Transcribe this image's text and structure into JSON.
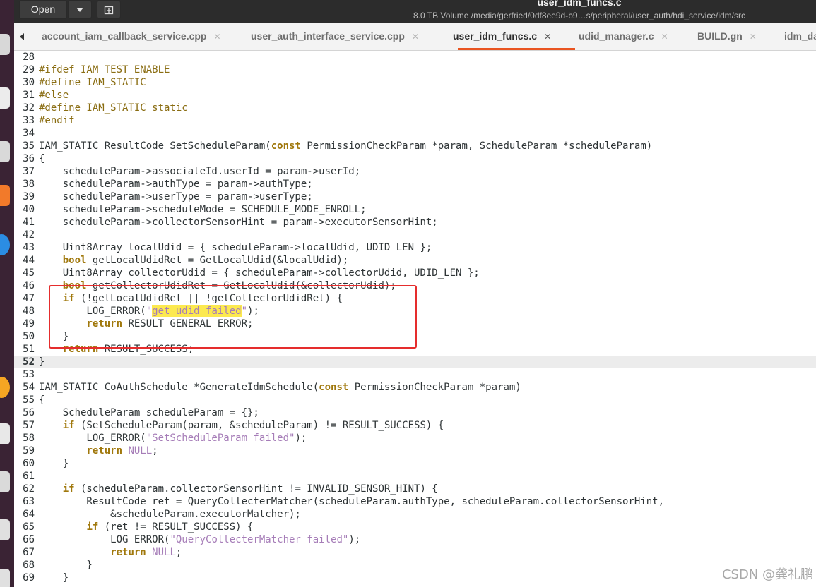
{
  "header": {
    "open_label": "Open",
    "window_title": "user_idm_funcs.c",
    "window_subtitle": "8.0 TB Volume /media/gerfried/0df8ee9d-b9…s/peripheral/user_auth/hdi_service/idm/src"
  },
  "tabs": [
    {
      "label": "account_iam_callback_service.cpp",
      "active": false
    },
    {
      "label": "user_auth_interface_service.cpp",
      "active": false
    },
    {
      "label": "user_idm_funcs.c",
      "active": true
    },
    {
      "label": "udid_manager.c",
      "active": false
    },
    {
      "label": "BUILD.gn",
      "active": false
    },
    {
      "label": "idm_da",
      "active": false
    }
  ],
  "editor": {
    "current_line": 52,
    "lines": [
      {
        "n": "28",
        "code": ""
      },
      {
        "n": "29",
        "code": "#ifdef IAM_TEST_ENABLE"
      },
      {
        "n": "30",
        "code": "#define IAM_STATIC"
      },
      {
        "n": "31",
        "code": "#else"
      },
      {
        "n": "32",
        "code": "#define IAM_STATIC static"
      },
      {
        "n": "33",
        "code": "#endif"
      },
      {
        "n": "34",
        "code": ""
      },
      {
        "n": "35",
        "code": "IAM_STATIC ResultCode SetScheduleParam(const PermissionCheckParam *param, ScheduleParam *scheduleParam)"
      },
      {
        "n": "36",
        "code": "{"
      },
      {
        "n": "37",
        "code": "    scheduleParam->associateId.userId = param->userId;"
      },
      {
        "n": "38",
        "code": "    scheduleParam->authType = param->authType;"
      },
      {
        "n": "39",
        "code": "    scheduleParam->userType = param->userType;"
      },
      {
        "n": "40",
        "code": "    scheduleParam->scheduleMode = SCHEDULE_MODE_ENROLL;"
      },
      {
        "n": "41",
        "code": "    scheduleParam->collectorSensorHint = param->executorSensorHint;"
      },
      {
        "n": "42",
        "code": ""
      },
      {
        "n": "43",
        "code": "    Uint8Array localUdid = { scheduleParam->localUdid, UDID_LEN };"
      },
      {
        "n": "44",
        "code": "    bool getLocalUdidRet = GetLocalUdid(&localUdid);"
      },
      {
        "n": "45",
        "code": "    Uint8Array collectorUdid = { scheduleParam->collectorUdid, UDID_LEN };"
      },
      {
        "n": "46",
        "code": "    bool getCollectorUdidRet = GetLocalUdid(&collectorUdid);"
      },
      {
        "n": "47",
        "code": "    if (!getLocalUdidRet || !getCollectorUdidRet) {"
      },
      {
        "n": "48",
        "code": "        LOG_ERROR(\"get udid failed\");"
      },
      {
        "n": "49",
        "code": "        return RESULT_GENERAL_ERROR;"
      },
      {
        "n": "50",
        "code": "    }"
      },
      {
        "n": "51",
        "code": "    return RESULT_SUCCESS;"
      },
      {
        "n": "52",
        "code": "}"
      },
      {
        "n": "53",
        "code": ""
      },
      {
        "n": "54",
        "code": "IAM_STATIC CoAuthSchedule *GenerateIdmSchedule(const PermissionCheckParam *param)"
      },
      {
        "n": "55",
        "code": "{"
      },
      {
        "n": "56",
        "code": "    ScheduleParam scheduleParam = {};"
      },
      {
        "n": "57",
        "code": "    if (SetScheduleParam(param, &scheduleParam) != RESULT_SUCCESS) {"
      },
      {
        "n": "58",
        "code": "        LOG_ERROR(\"SetScheduleParam failed\");"
      },
      {
        "n": "59",
        "code": "        return NULL;"
      },
      {
        "n": "60",
        "code": "    }"
      },
      {
        "n": "61",
        "code": ""
      },
      {
        "n": "62",
        "code": "    if (scheduleParam.collectorSensorHint != INVALID_SENSOR_HINT) {"
      },
      {
        "n": "63",
        "code": "        ResultCode ret = QueryCollecterMatcher(scheduleParam.authType, scheduleParam.collectorSensorHint,"
      },
      {
        "n": "64",
        "code": "            &scheduleParam.executorMatcher);"
      },
      {
        "n": "65",
        "code": "        if (ret != RESULT_SUCCESS) {"
      },
      {
        "n": "66",
        "code": "            LOG_ERROR(\"QueryCollecterMatcher failed\");"
      },
      {
        "n": "67",
        "code": "            return NULL;"
      },
      {
        "n": "68",
        "code": "        }"
      },
      {
        "n": "69",
        "code": "    }"
      }
    ],
    "search_highlight": "get udid failed"
  },
  "watermark": "CSDN @龚礼鹏",
  "colors": {
    "keyword": "#a0780c",
    "string": "#a67db8",
    "highlight": "#fce94f",
    "annotation_box": "#e52d2d",
    "tab_accent": "#e95420"
  }
}
